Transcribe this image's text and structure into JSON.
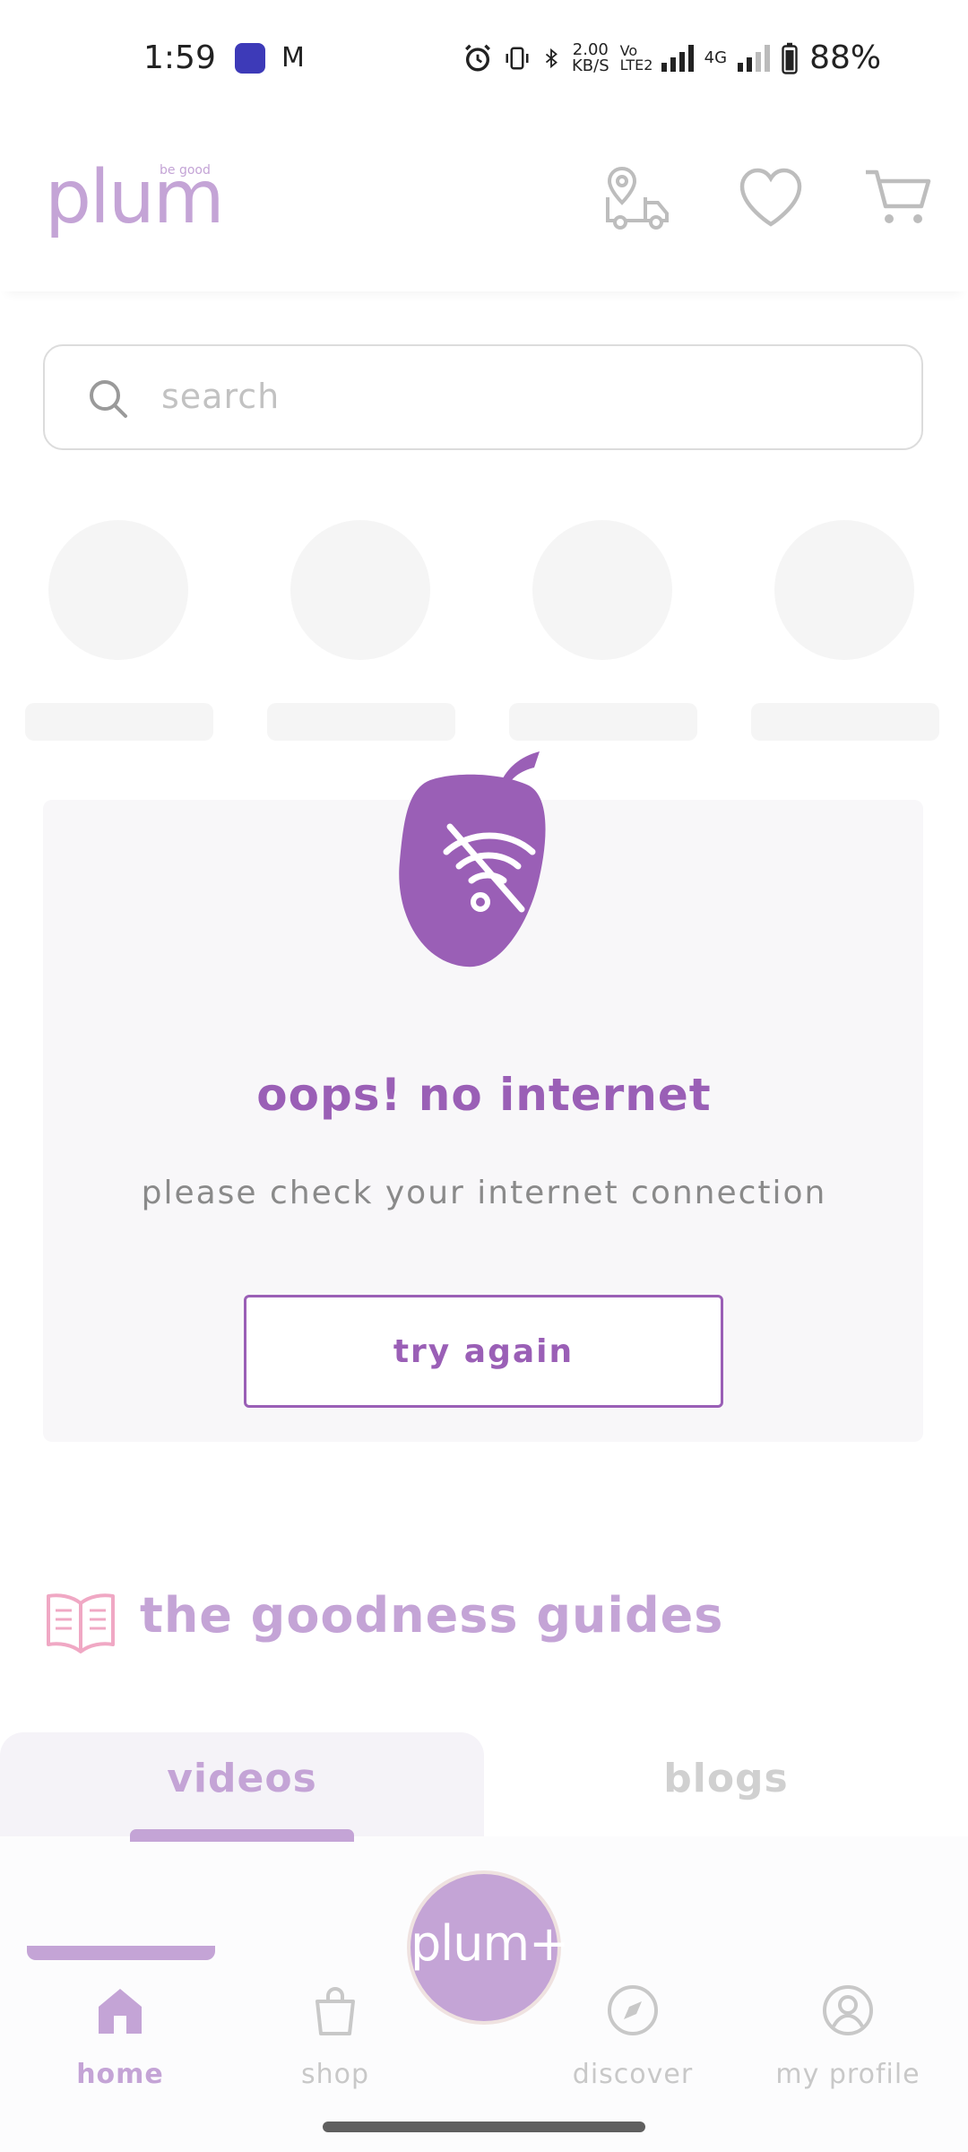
{
  "status_bar": {
    "time": "1:59",
    "gmail_icon": "M",
    "net_speed_value": "2.00",
    "net_speed_unit": "KB/S",
    "volte": "Vo LTE2",
    "network": "4G",
    "battery": "88%"
  },
  "header": {
    "logo_text": "plum",
    "logo_tagline": "be good",
    "icons": [
      "delivery-truck-icon",
      "heart-icon",
      "cart-icon"
    ]
  },
  "search": {
    "placeholder": "search"
  },
  "error": {
    "title": "oops! no internet",
    "subtitle": "please check your internet connection",
    "button_label": "try again"
  },
  "guides": {
    "title": "the goodness guides",
    "tabs": [
      {
        "label": "videos",
        "active": true
      },
      {
        "label": "blogs",
        "active": false
      }
    ]
  },
  "bottom_nav": {
    "plus_label": "plum+",
    "items": [
      {
        "label": "home",
        "icon": "home-icon",
        "active": true
      },
      {
        "label": "shop",
        "icon": "shopping-bag-icon",
        "active": false
      },
      {
        "label": "discover",
        "icon": "compass-icon",
        "active": false
      },
      {
        "label": "my profile",
        "icon": "profile-icon",
        "active": false
      }
    ]
  },
  "colors": {
    "brand_purple": "#9a5fb6",
    "brand_light": "#c4a4d6",
    "muted": "#c8c8c8"
  }
}
